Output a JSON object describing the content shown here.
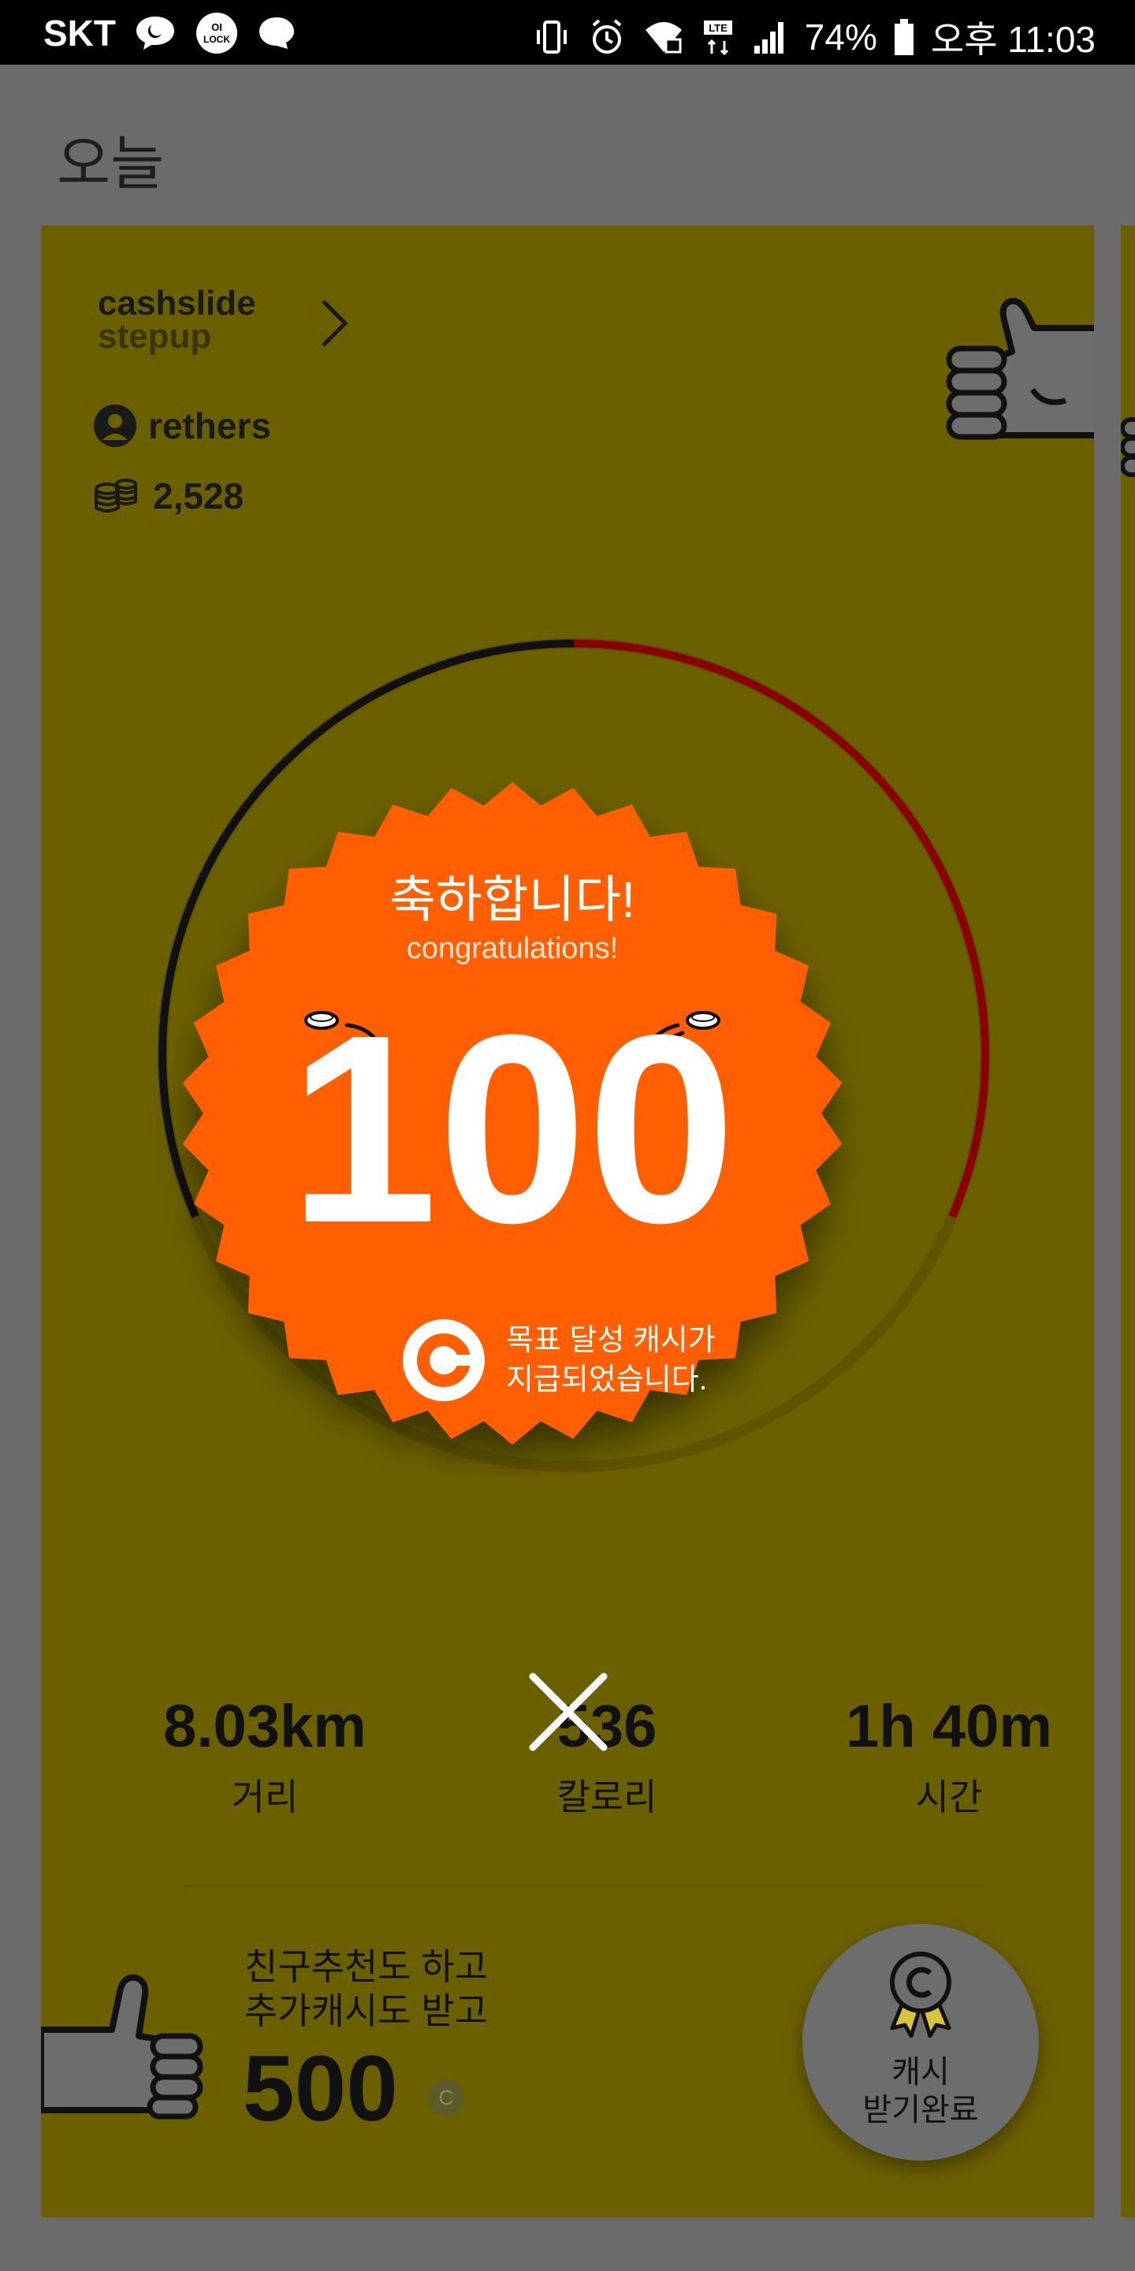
{
  "status_bar": {
    "carrier": "SKT",
    "battery": "74%",
    "time": "오후 11:03",
    "lte": "LTE"
  },
  "page": {
    "title": "오늘"
  },
  "card": {
    "brand_line1": "cashslide",
    "brand_line2": "stepup",
    "username": "rethers",
    "cash_balance": "2,528"
  },
  "goal_popup": {
    "title_ko": "축하합니다!",
    "title_en": "congratulations!",
    "amount": "100",
    "message_line1": "목표 달성 캐시가",
    "message_line2": "지급되었습니다."
  },
  "stats": [
    {
      "value": "8.03km",
      "label": "거리"
    },
    {
      "value": "536",
      "label": "칼로리"
    },
    {
      "value": "1h 40m",
      "label": "시간"
    }
  ],
  "referral": {
    "line1": "친구추천도 하고",
    "line2": "추가캐시도 받고",
    "amount": "500",
    "coin_letter": "C"
  },
  "claim_button": {
    "line1": "캐시",
    "line2": "받기완료"
  },
  "colors": {
    "card_bg": "#6b6000",
    "badge": "#ff5f00",
    "overlay": "#6b6b6b",
    "ring_red": "#8a0000"
  }
}
